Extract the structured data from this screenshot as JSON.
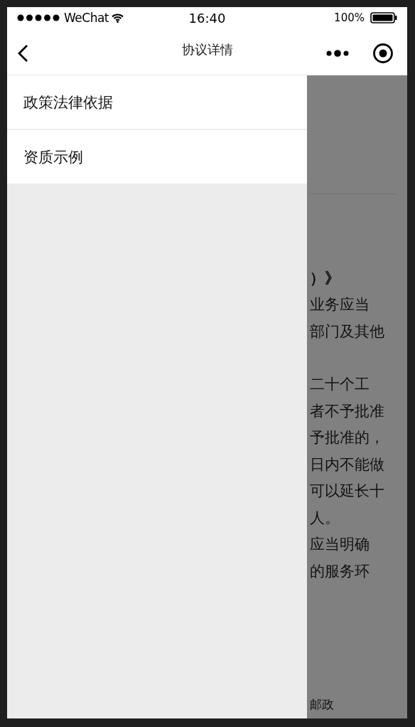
{
  "status_bar": {
    "carrier": "WeChat",
    "time": "16:40",
    "battery": "100%"
  },
  "nav_bar": {
    "title": "协议详情"
  },
  "drawer": {
    "items": [
      {
        "label": "政策法律依据"
      },
      {
        "label": "资质示例"
      }
    ]
  },
  "background_page": {
    "heading": "）》",
    "paragraphs": [
      [
        "业务应当",
        "部门及其他"
      ],
      [
        "二十个工",
        "者不予批准",
        "予批准的，",
        "日内不能做",
        "可以延长十",
        "人。",
        "应当明确",
        "的服务环"
      ]
    ],
    "footer": "邮政"
  }
}
